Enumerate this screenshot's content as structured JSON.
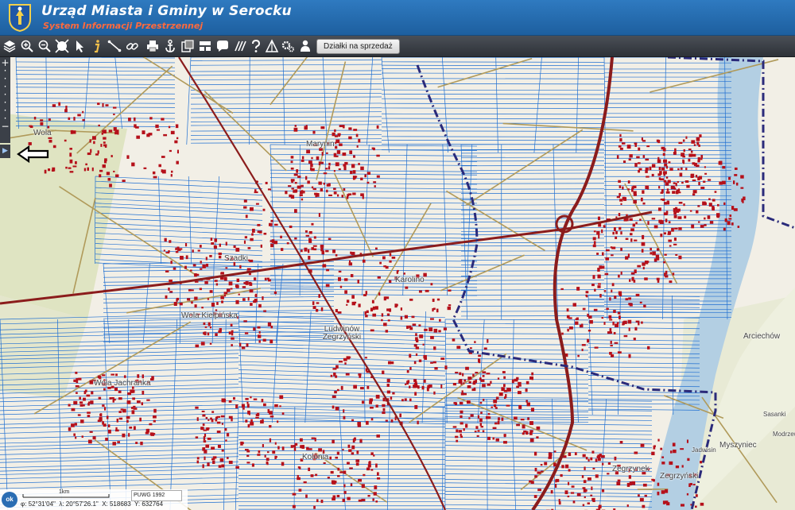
{
  "header": {
    "title": "Urząd Miasta i Gminy w Serocku",
    "subtitle": "System Informacji Przestrzennej"
  },
  "toolbar": {
    "tools": [
      "layers-icon",
      "zoom-in-icon",
      "zoom-out-icon",
      "full-extent-icon",
      "select-arrow-icon",
      "info-icon",
      "measure-distance-icon",
      "link-icon",
      "print-icon",
      "anchor-icon",
      "export-icon",
      "bubble-icon",
      "layout-icon",
      "filter-icon",
      "hatch-icon",
      "help-icon",
      "triangle-icon",
      "gears-icon",
      "user-location-icon"
    ],
    "sale_button": "Działki na sprzedaż"
  },
  "map": {
    "labels": [
      "Wola",
      "Marynin",
      "Szadki",
      "Karolino",
      "Wola Kiełpińska",
      "Ludwinów Zegrzyński",
      "Arciechów",
      "Wola Jachranka",
      "Myszyniec",
      "Sasanki",
      "Modrzewie",
      "Zegrzynek",
      "Zegrzyński",
      "Jadwisin",
      "Kolonia"
    ],
    "colors": {
      "background": "#f2efe6",
      "parcel": "#1f6fd1",
      "building": "#b5101a",
      "road": "#8b1c1c",
      "boundary": "#2a2a7a",
      "water": "#b3cfe3"
    }
  },
  "side_panel": {
    "zoom_in": "+",
    "zoom_out": "−",
    "toggle": "▶"
  },
  "status": {
    "ok_label": "ok",
    "scale_label": "1km",
    "crs": "PUWG 1992",
    "lat": "φ: 52°31'04\"",
    "lon": "λ: 20°57'26.1\"",
    "x": "X: 518683",
    "y": "Y: 632764"
  }
}
